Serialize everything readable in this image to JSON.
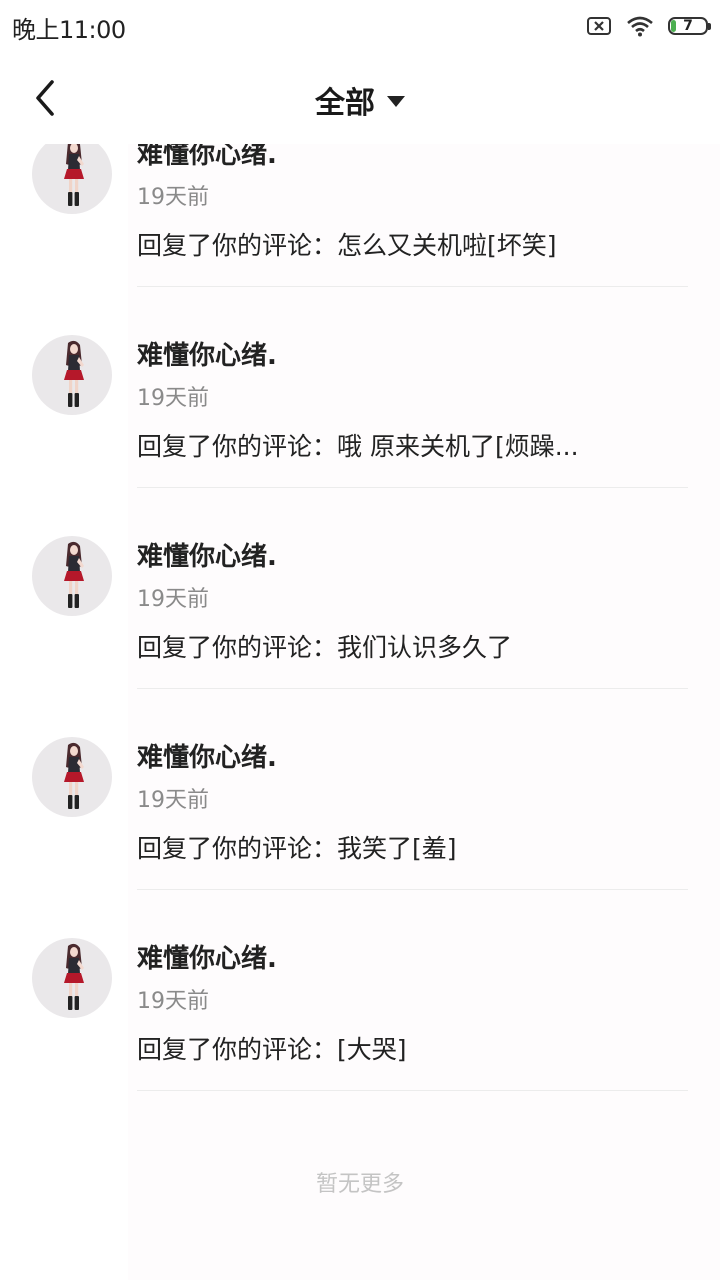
{
  "status_bar": {
    "time": "晚上11:00",
    "battery_level": "7",
    "icons": [
      "sim-disabled-icon",
      "wifi-icon",
      "battery-icon"
    ],
    "battery_color": "#4caf50"
  },
  "header": {
    "back_icon": "chevron-left-icon",
    "title": "全部",
    "dropdown_icon": "caret-down-icon"
  },
  "items": [
    {
      "name": "难懂你心绪.",
      "time": "19天前",
      "message": "回复了你的评论：怎么又关机啦[坏笑]"
    },
    {
      "name": "难懂你心绪.",
      "time": "19天前",
      "message": "回复了你的评论：哦 原来关机了[烦躁..."
    },
    {
      "name": "难懂你心绪.",
      "time": "19天前",
      "message": "回复了你的评论：我们认识多久了"
    },
    {
      "name": "难懂你心绪.",
      "time": "19天前",
      "message": "回复了你的评论：我笑了[羞]"
    },
    {
      "name": "难懂你心绪.",
      "time": "19天前",
      "message": "回复了你的评论：[大哭]"
    }
  ],
  "footer": {
    "text": "暂无更多"
  },
  "colors": {
    "primary_text": "#222222",
    "secondary_text": "#8a8a8a",
    "footer_text": "#c4c4c4",
    "avatar_bg": "#eae8ea"
  }
}
